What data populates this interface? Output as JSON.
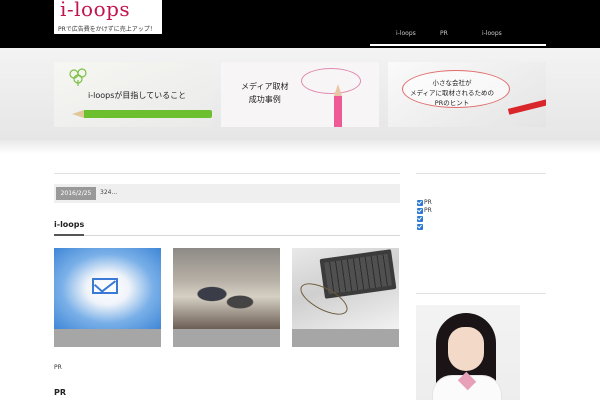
{
  "header": {
    "logo_text": "i-loops",
    "logo_tagline": "PRで広告費をかけずに売上アップ！",
    "nav": [
      "i-loops",
      "PR",
      "i-loops"
    ]
  },
  "promos": [
    {
      "label": "i-loopsが目指していること"
    },
    {
      "label_line1": "メディア取材",
      "label_line2": "成功事例"
    },
    {
      "label_line1": "小さな会社が",
      "label_line2": "メディアに取材されるための",
      "label_line3": "PRのヒント"
    }
  ],
  "news": {
    "date": "2016/2/25",
    "text": "324..."
  },
  "section_title": "i-loops",
  "thumbs": [
    {
      "caption": ""
    },
    {
      "caption": ""
    },
    {
      "caption": ""
    }
  ],
  "caption_pr": "PR",
  "section2_title": "PR",
  "sidebar": {
    "items": [
      "PR",
      "PR",
      "",
      ""
    ]
  },
  "colors": {
    "brand": "#c0154e",
    "header_bg": "#000000",
    "accent_check": "#2b7bd6"
  }
}
